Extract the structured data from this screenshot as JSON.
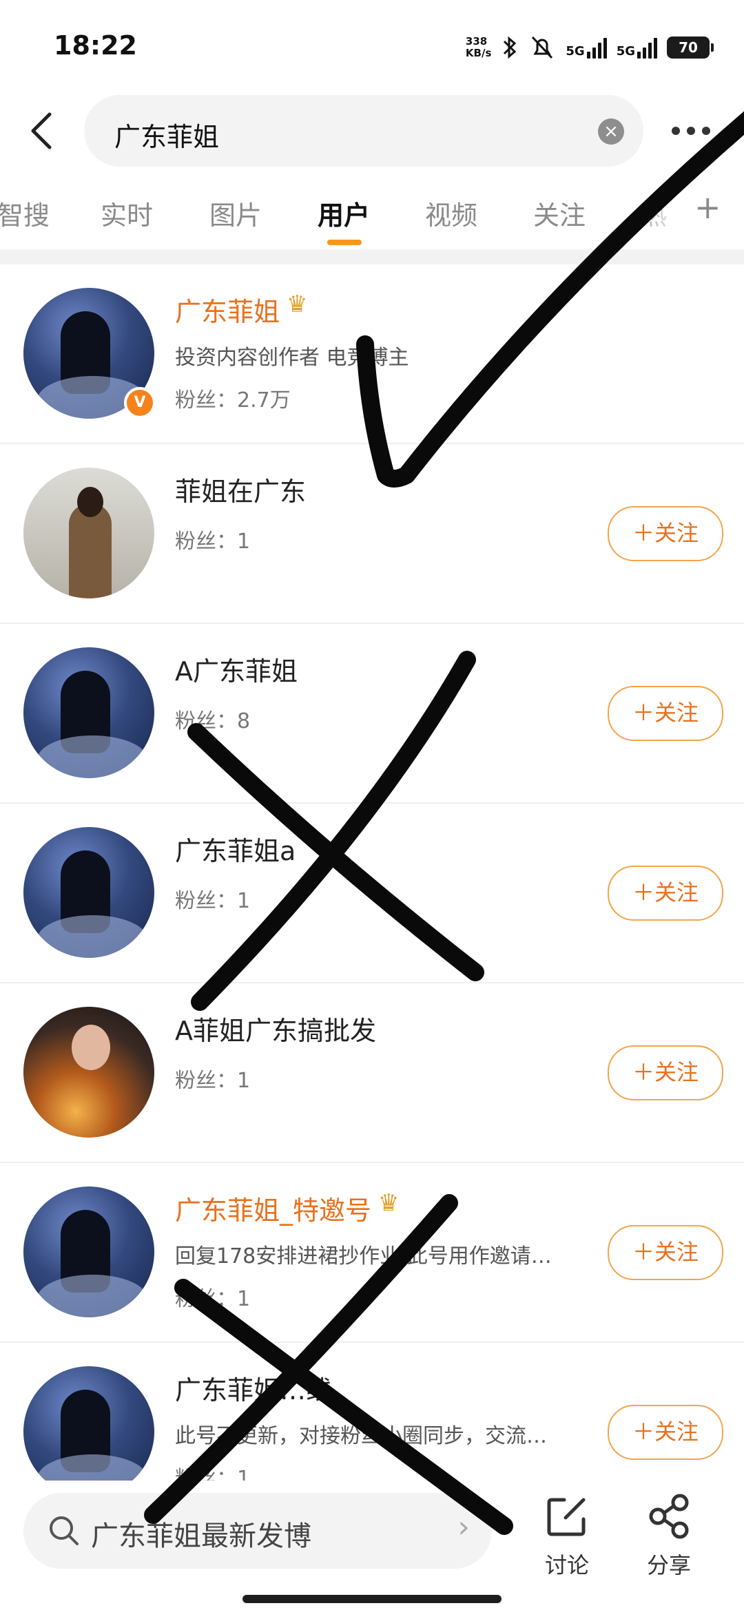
{
  "status_bar": {
    "time": "18:22",
    "net_speed_value": "338",
    "net_speed_unit": "KB/s",
    "sim1": "5G",
    "sim2": "5G",
    "battery": "70"
  },
  "search": {
    "query": "广东菲姐",
    "clear_icon": "×"
  },
  "tabs": [
    {
      "label": "智搜",
      "active": false
    },
    {
      "label": "实时",
      "active": false
    },
    {
      "label": "图片",
      "active": false
    },
    {
      "label": "用户",
      "active": true
    },
    {
      "label": "视频",
      "active": false
    },
    {
      "label": "关注",
      "active": false
    },
    {
      "label": "热",
      "active": false
    }
  ],
  "tab_add": "+",
  "users": [
    {
      "name": "广东菲姐",
      "vip": true,
      "verified": true,
      "desc": "投资内容创作者 电竞博主",
      "fans": "粉丝：2.7万",
      "avatar": "night-silhouette",
      "follow": null
    },
    {
      "name": "菲姐在广东",
      "vip": false,
      "verified": false,
      "desc": "",
      "fans": "粉丝：1",
      "avatar": "woman-in-coat",
      "follow": "＋关注"
    },
    {
      "name": "A广东菲姐",
      "vip": false,
      "verified": false,
      "desc": "",
      "fans": "粉丝：8",
      "avatar": "night-silhouette",
      "follow": "＋关注"
    },
    {
      "name": "广东菲姐a",
      "vip": false,
      "verified": false,
      "desc": "",
      "fans": "粉丝：1",
      "avatar": "night-silhouette",
      "follow": "＋关注"
    },
    {
      "name": "A菲姐广东搞批发",
      "vip": false,
      "verified": false,
      "desc": "",
      "fans": "粉丝：1",
      "avatar": "woman-fire",
      "follow": "＋关注"
    },
    {
      "name": "广东菲姐_特邀号",
      "vip": true,
      "verified": false,
      "desc": "回复178安排进裙抄作业 此号用作邀请…",
      "fans": "粉丝：1",
      "avatar": "night-silhouette",
      "follow": "＋关注"
    },
    {
      "name": "广东菲姐…线",
      "vip": false,
      "verified": false,
      "desc": "此号不更新，对接粉丝小圈同步，交流…",
      "fans": "粉丝：1",
      "avatar": "night-silhouette",
      "follow": "＋关注"
    }
  ],
  "bottom_bar": {
    "search_placeholder": "广东菲姐最新发博",
    "discuss_label": "讨论",
    "share_label": "分享"
  },
  "colors": {
    "accent": "#f7981c",
    "vip_name": "#e8711d",
    "follow_border": "#f3a54b",
    "annotation_ink": "#0a0a0a"
  },
  "icons": {
    "back": "back-arrow-icon",
    "more": "more-dots-icon",
    "clear": "clear-icon",
    "crown": "crown-icon",
    "verified": "verified-v-icon",
    "search": "search-icon",
    "discuss": "edit-icon",
    "share": "share-icon"
  }
}
